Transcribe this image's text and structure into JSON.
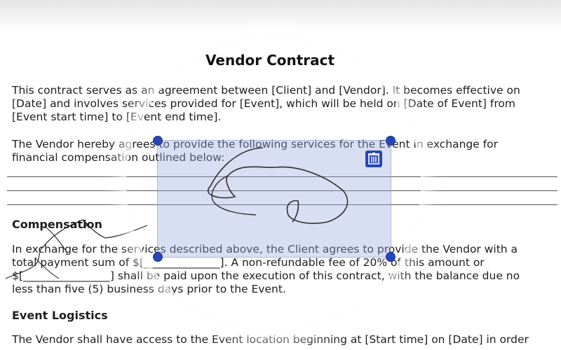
{
  "document": {
    "title": "Vendor Contract",
    "intro": "This contract serves as an agreement between [Client] and [Vendor]. It becomes effective on\n[Date] and involves services provided for [Event], which will be held on [Date of Event] from\n[Event start time] to [Event end time].",
    "services": "The Vendor hereby agrees to provide the following services for the Event in exchange for\nfinancial compensation outlined below:",
    "compensation_heading": "Compensation",
    "compensation": "In exchange for the services described above, the Client agrees to provide the Vendor with a\ntotal payment sum of $[______________]. A non-refundable fee of 20% of this amount or\n$[________________] shall be paid upon the execution of this contract, with the balance due no\nless than five (5) business days prior to the Event.",
    "logistics_heading": "Event Logistics",
    "logistics": "The Vendor shall have access to the Event location beginning at [Start time] on [Date] in order"
  },
  "signature_tool": {
    "delete_icon": "trash-icon",
    "accent_color": "#2646b8",
    "highlight_color": "#9cabde"
  }
}
